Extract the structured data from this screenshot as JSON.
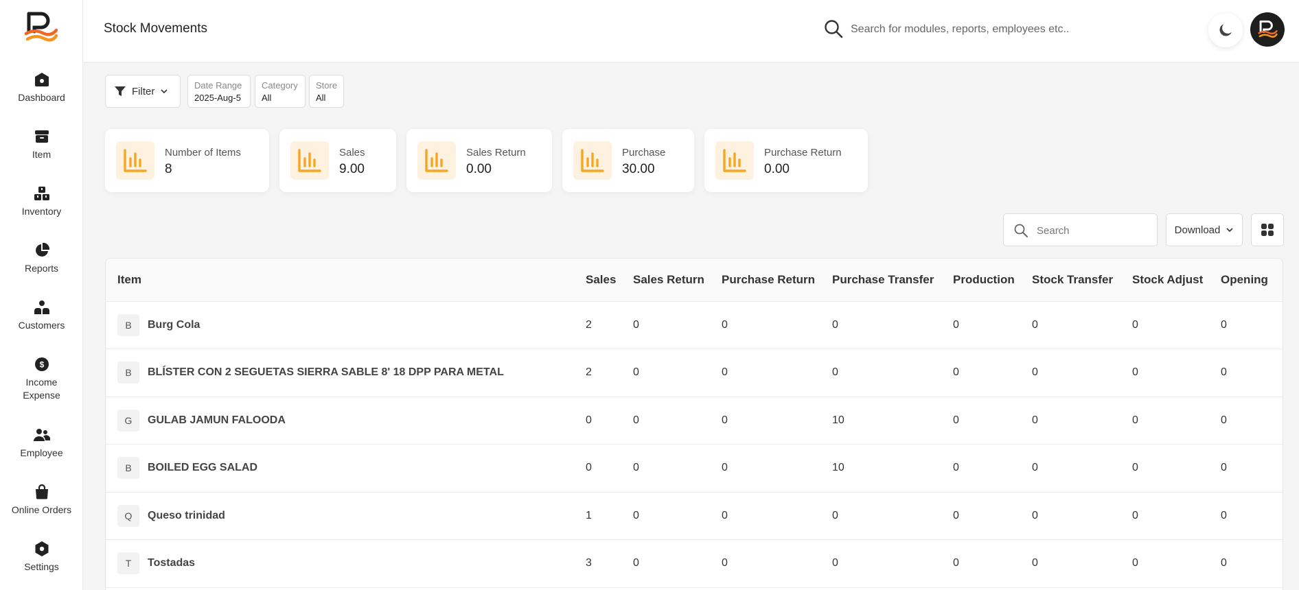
{
  "header": {
    "title": "Stock Movements",
    "search_placeholder": "Search for modules, reports, employees etc.."
  },
  "sidebar": {
    "items": [
      {
        "label": "Dashboard",
        "icon": "dashboard-icon"
      },
      {
        "label": "Item",
        "icon": "archive-box-icon"
      },
      {
        "label": "Inventory",
        "icon": "boxes-icon"
      },
      {
        "label": "Reports",
        "icon": "pie-chart-icon"
      },
      {
        "label": "Customers",
        "icon": "users-icon"
      },
      {
        "label": "Income",
        "label2": "Expense",
        "icon": "dollar-circle-icon"
      },
      {
        "label": "Employee",
        "icon": "people-icon"
      },
      {
        "label": "Online Orders",
        "icon": "shopping-bag-icon"
      },
      {
        "label": "Settings",
        "icon": "hexagon-settings-icon"
      }
    ]
  },
  "filters": {
    "button_label": "Filter",
    "chips": [
      {
        "label": "Date Range",
        "value": "2025-Aug-5"
      },
      {
        "label": "Category",
        "value": "All"
      },
      {
        "label": "Store",
        "value": "All"
      }
    ]
  },
  "stats": [
    {
      "label": "Number of Items",
      "value": "8"
    },
    {
      "label": "Sales",
      "value": "9.00"
    },
    {
      "label": "Sales Return",
      "value": "0.00"
    },
    {
      "label": "Purchase",
      "value": "30.00"
    },
    {
      "label": "Purchase Return",
      "value": "0.00"
    }
  ],
  "toolbar": {
    "search_placeholder": "Search",
    "download_label": "Download"
  },
  "table": {
    "columns": [
      "Item",
      "Sales",
      "Sales Return",
      "Purchase Return",
      "Purchase Transfer",
      "Production",
      "Stock Transfer",
      "Stock Adjust",
      "Opening"
    ],
    "rows": [
      {
        "initial": "B",
        "name": "Burg Cola",
        "cells": [
          "2",
          "0",
          "0",
          "0",
          "0",
          "0",
          "0",
          "0"
        ]
      },
      {
        "initial": "B",
        "name": "BLÍSTER CON 2 SEGUETAS SIERRA SABLE 8' 18 DPP PARA METAL",
        "cells": [
          "2",
          "0",
          "0",
          "0",
          "0",
          "0",
          "0",
          "0"
        ]
      },
      {
        "initial": "G",
        "name": "GULAB JAMUN FALOODA",
        "cells": [
          "0",
          "0",
          "0",
          "10",
          "0",
          "0",
          "0",
          "0"
        ]
      },
      {
        "initial": "B",
        "name": "BOILED EGG SALAD",
        "cells": [
          "0",
          "0",
          "0",
          "10",
          "0",
          "0",
          "0",
          "0"
        ]
      },
      {
        "initial": "Q",
        "name": "Queso trinidad",
        "cells": [
          "1",
          "0",
          "0",
          "0",
          "0",
          "0",
          "0",
          "0"
        ]
      },
      {
        "initial": "T",
        "name": "Tostadas",
        "cells": [
          "3",
          "0",
          "0",
          "0",
          "0",
          "0",
          "0",
          "0"
        ]
      }
    ]
  },
  "colors": {
    "accent": "#f5a623",
    "accent_bg": "#fff1df",
    "logo_orange": "#f26522",
    "logo_dark": "#1e1e1e"
  }
}
